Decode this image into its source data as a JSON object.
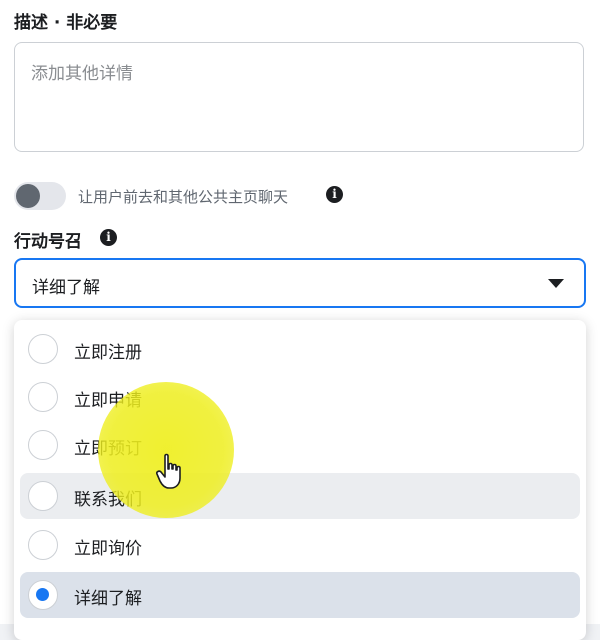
{
  "description": {
    "label": "描述 · 非必要",
    "placeholder": "添加其他详情"
  },
  "toggle": {
    "label": "让用户前去和其他公共主页聊天",
    "on": false
  },
  "call_to_action": {
    "label": "行动号召",
    "selected_value": "详细了解",
    "options": [
      {
        "label": "立即注册",
        "selected": false
      },
      {
        "label": "立即申请",
        "selected": false
      },
      {
        "label": "立即预订",
        "selected": false
      },
      {
        "label": "联系我们",
        "selected": false
      },
      {
        "label": "立即询价",
        "selected": false
      },
      {
        "label": "详细了解",
        "selected": true
      }
    ]
  },
  "colors": {
    "accent": "#1877f2",
    "highlight": "#eeee1e"
  }
}
